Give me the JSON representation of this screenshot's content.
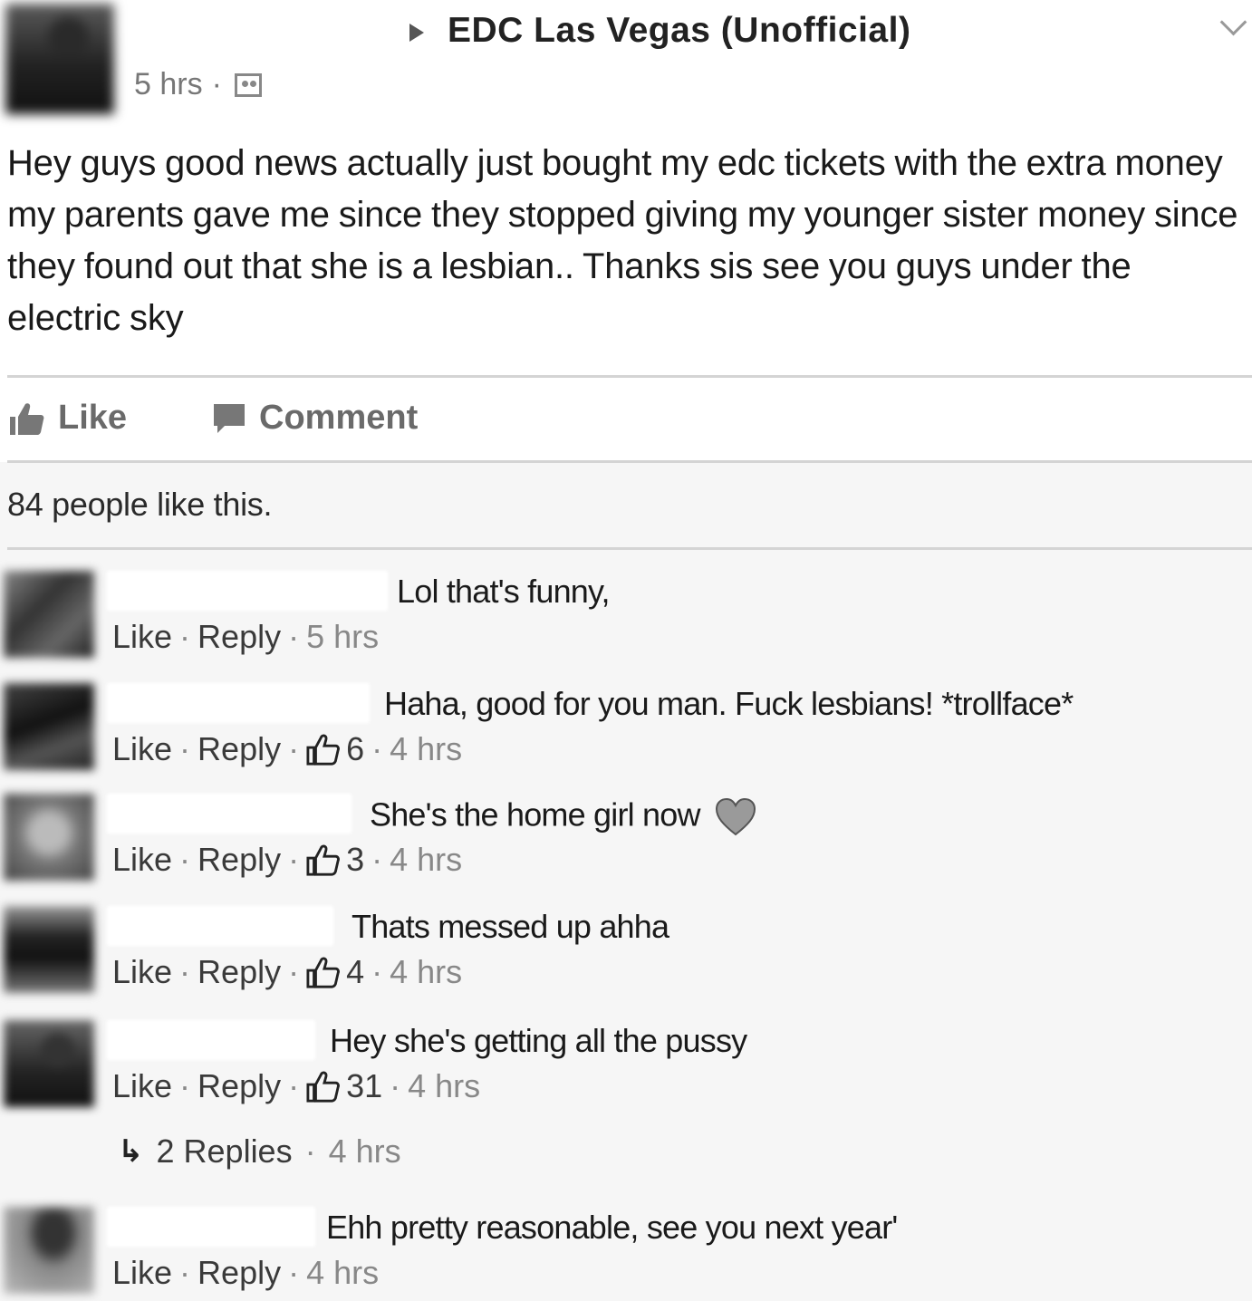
{
  "post": {
    "group_name": "EDC Las Vegas (Unofficial)",
    "time": "5 hrs",
    "separator": "·",
    "audience_icon": "group-audience-icon",
    "body": "Hey guys good news actually just bought my edc tickets with the extra money my parents gave me since they stopped giving my younger sister money since they found out that she is a lesbian.. Thanks sis see you guys under the electric sky"
  },
  "actions": {
    "like_label": "Like",
    "comment_label": "Comment"
  },
  "likes_summary": "84 people like this.",
  "comment_actions": {
    "like": "Like",
    "reply": "Reply",
    "dot": "·"
  },
  "comments": [
    {
      "text": "Lol that's funny,",
      "reactions": "",
      "time": "5 hrs"
    },
    {
      "text": "Haha, good for you man. Fuck lesbians! *trollface*",
      "reactions": "6",
      "time": "4 hrs"
    },
    {
      "text": "She's the home girl now",
      "reactions": "3",
      "time": "4 hrs",
      "emoji": "heart-icon"
    },
    {
      "text": "Thats messed up ahha",
      "reactions": "4",
      "time": "4 hrs"
    },
    {
      "text": "Hey she's getting all the pussy",
      "reactions": "31",
      "time": "4 hrs"
    },
    {
      "text": "Ehh pretty reasonable, see you next year'",
      "reactions": "",
      "time": "4 hrs"
    }
  ],
  "replies": {
    "label": "2 Replies",
    "time": "4 hrs"
  },
  "colors": {
    "background": "#f6f6f6",
    "post_background": "#ffffff",
    "text": "#1a1a1a",
    "muted": "#888888"
  }
}
